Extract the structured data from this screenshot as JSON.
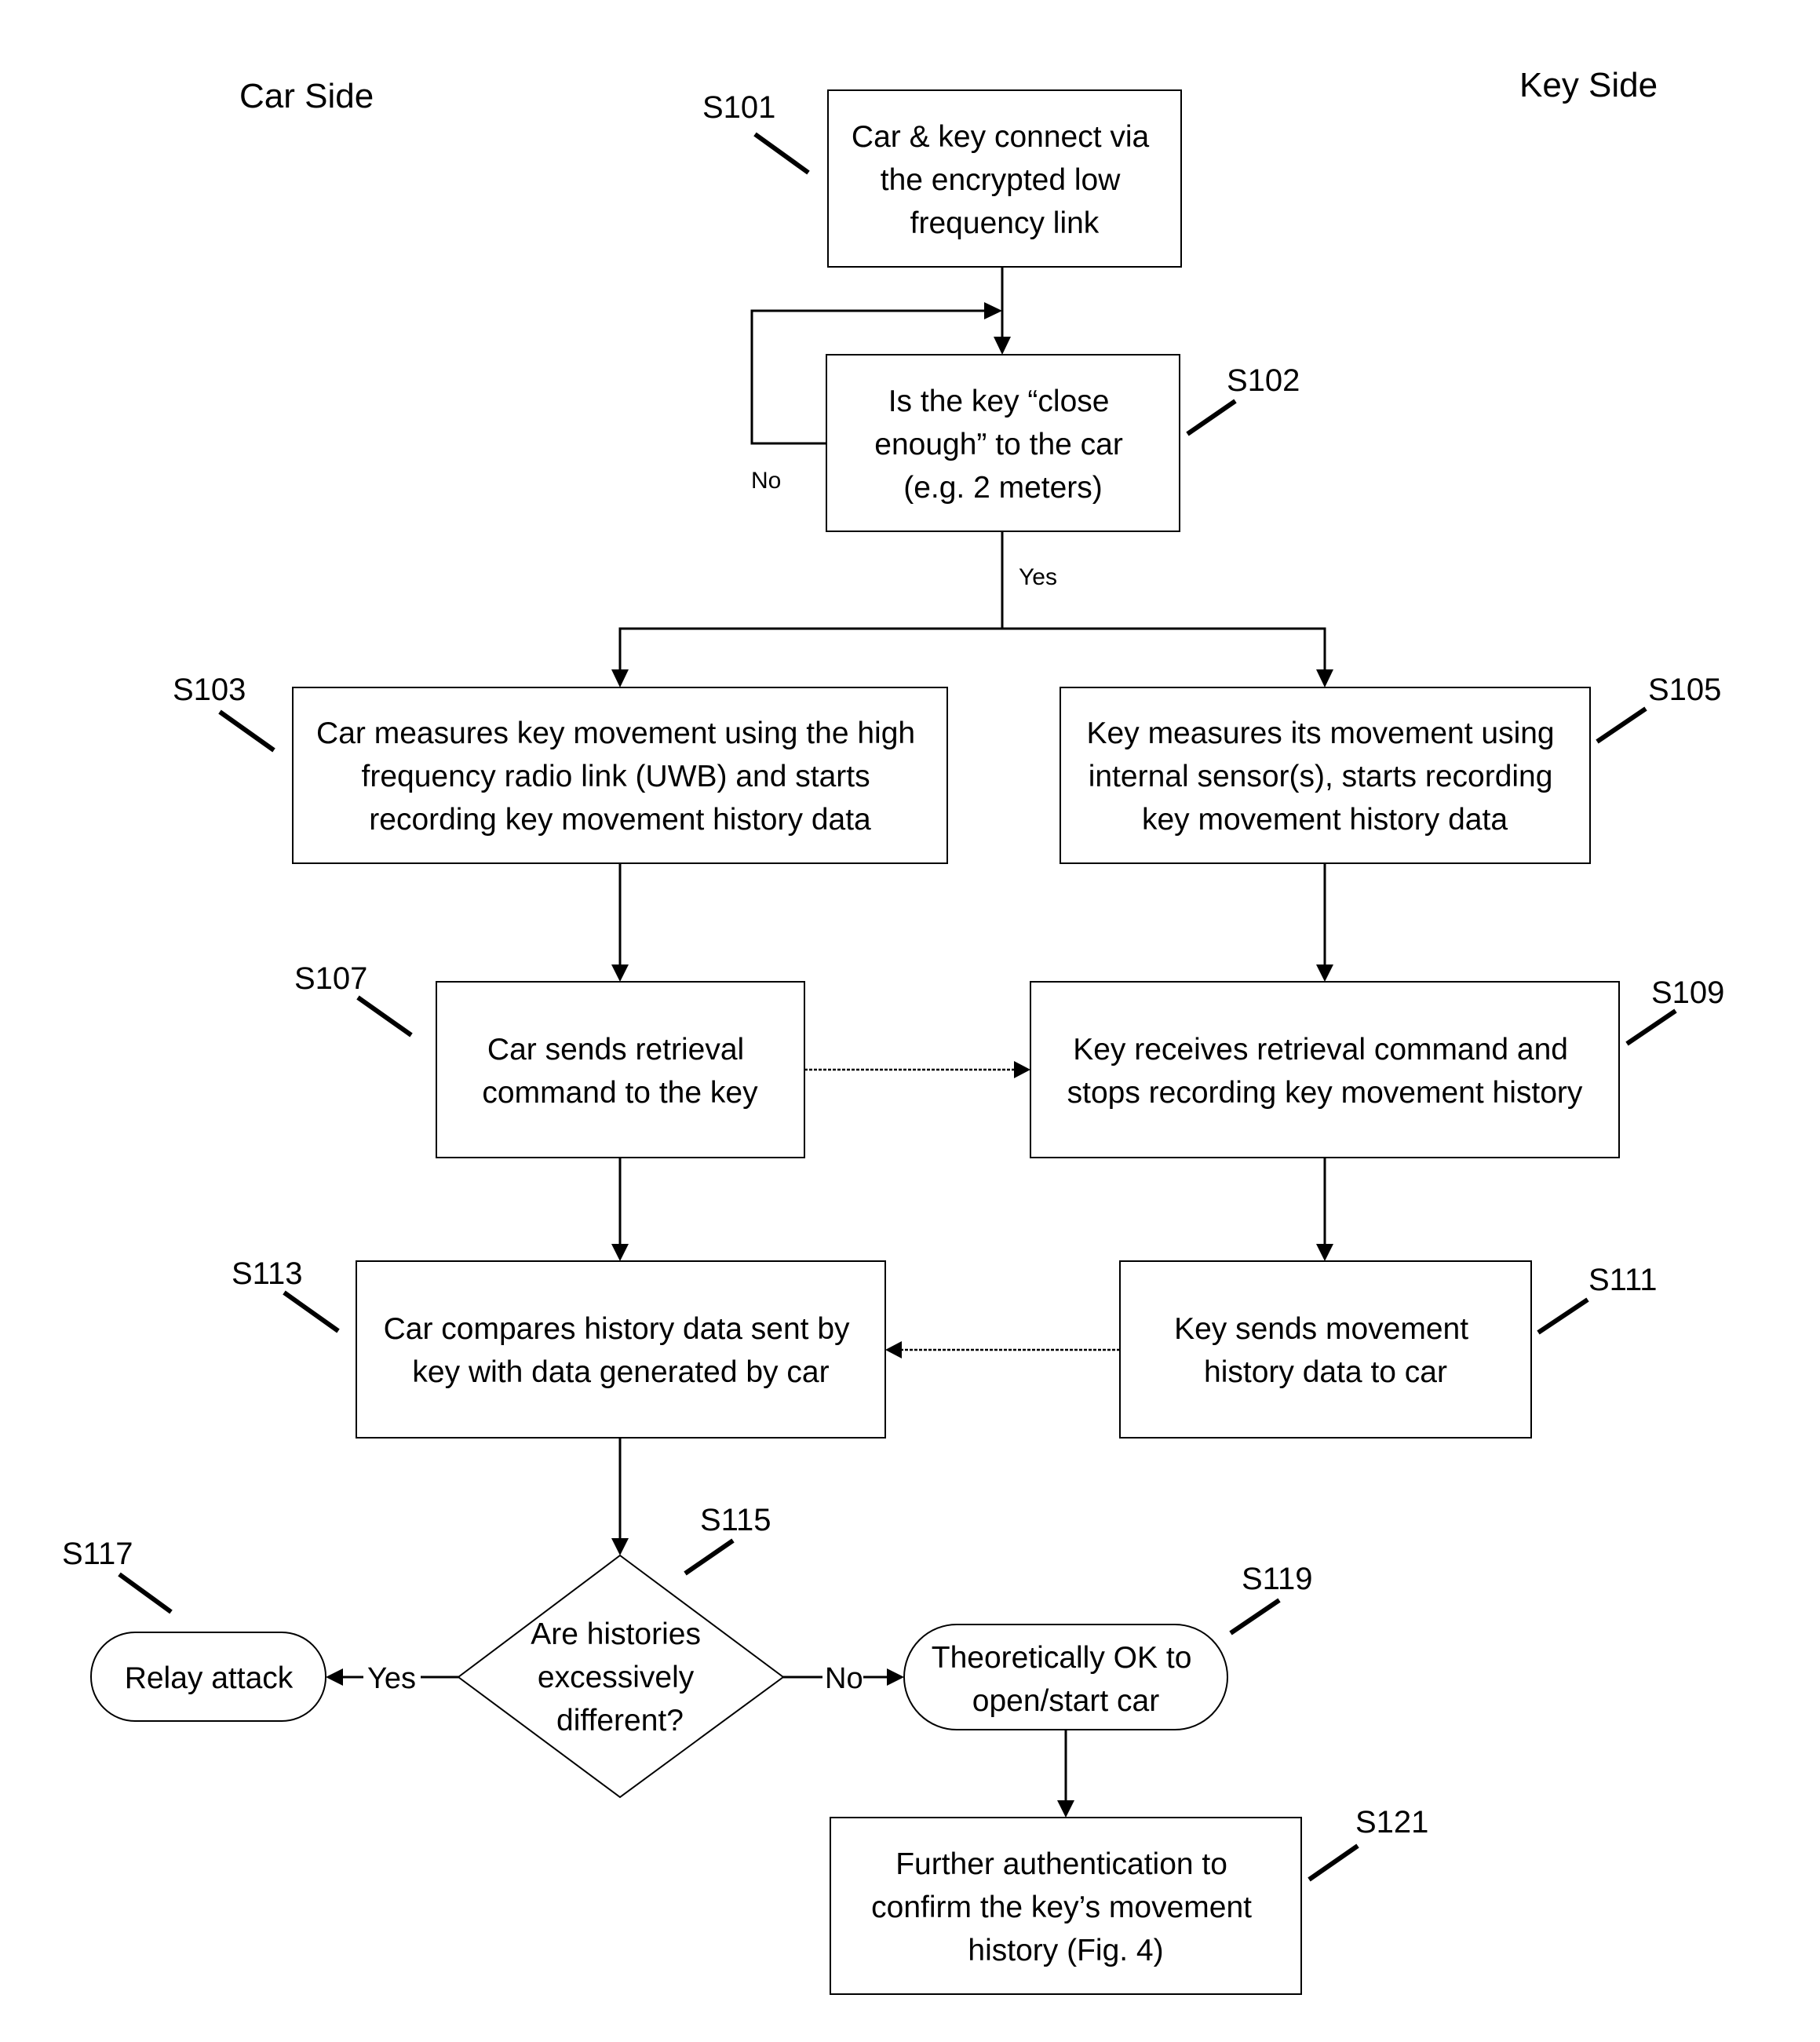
{
  "header": {
    "car_side": "Car Side",
    "key_side": "Key Side"
  },
  "nodes": {
    "s101": {
      "id": "S101",
      "shape": "process",
      "lines": [
        "Car & key connect via",
        "the encrypted low",
        "frequency link"
      ]
    },
    "s102": {
      "id": "S102",
      "shape": "process",
      "lines": [
        "Is the key “close",
        "enough” to the car",
        "(e.g. 2 meters)"
      ]
    },
    "s103": {
      "id": "S103",
      "shape": "process",
      "lines": [
        "Car measures key movement using the high",
        "frequency radio link (UWB) and starts",
        "recording key movement history data"
      ]
    },
    "s105": {
      "id": "S105",
      "shape": "process",
      "lines": [
        "Key measures its movement using",
        "internal sensor(s), starts recording",
        "key movement history data"
      ]
    },
    "s107": {
      "id": "S107",
      "shape": "process",
      "lines": [
        "Car sends retrieval",
        "command to the key"
      ]
    },
    "s109": {
      "id": "S109",
      "shape": "process",
      "lines": [
        "Key receives retrieval command and",
        "stops recording key movement history"
      ]
    },
    "s111": {
      "id": "S111",
      "shape": "process",
      "lines": [
        "Key sends movement",
        "history data to car"
      ]
    },
    "s113": {
      "id": "S113",
      "shape": "process",
      "lines": [
        "Car compares history data sent by",
        "key with data generated by car"
      ]
    },
    "s115": {
      "id": "S115",
      "shape": "decision",
      "lines": [
        "Are histories",
        "excessively",
        "different?"
      ]
    },
    "s117": {
      "id": "S117",
      "shape": "terminal",
      "lines": [
        "Relay attack"
      ]
    },
    "s119": {
      "id": "S119",
      "shape": "terminal",
      "lines": [
        "Theoretically OK to",
        "open/start car"
      ]
    },
    "s121": {
      "id": "S121",
      "shape": "process",
      "lines": [
        "Further authentication to",
        "confirm the key’s movement",
        "history (Fig. 4)"
      ]
    }
  },
  "edges": {
    "s102_no": "No",
    "s102_yes": "Yes",
    "s115_yes": "Yes",
    "s115_no": "No"
  },
  "connections": [
    {
      "from": "S101",
      "to": "S102",
      "style": "solid"
    },
    {
      "from": "S102",
      "to": "S102",
      "style": "solid",
      "label": "No"
    },
    {
      "from": "S102",
      "to": "S103",
      "style": "solid",
      "label": "Yes"
    },
    {
      "from": "S102",
      "to": "S105",
      "style": "solid",
      "label": "Yes"
    },
    {
      "from": "S103",
      "to": "S107",
      "style": "solid"
    },
    {
      "from": "S105",
      "to": "S109",
      "style": "solid"
    },
    {
      "from": "S107",
      "to": "S109",
      "style": "dashed"
    },
    {
      "from": "S107",
      "to": "S113",
      "style": "solid"
    },
    {
      "from": "S109",
      "to": "S111",
      "style": "solid"
    },
    {
      "from": "S111",
      "to": "S113",
      "style": "dashed"
    },
    {
      "from": "S113",
      "to": "S115",
      "style": "solid"
    },
    {
      "from": "S115",
      "to": "S117",
      "style": "solid",
      "label": "Yes"
    },
    {
      "from": "S115",
      "to": "S119",
      "style": "solid",
      "label": "No"
    },
    {
      "from": "S119",
      "to": "S121",
      "style": "solid"
    }
  ]
}
